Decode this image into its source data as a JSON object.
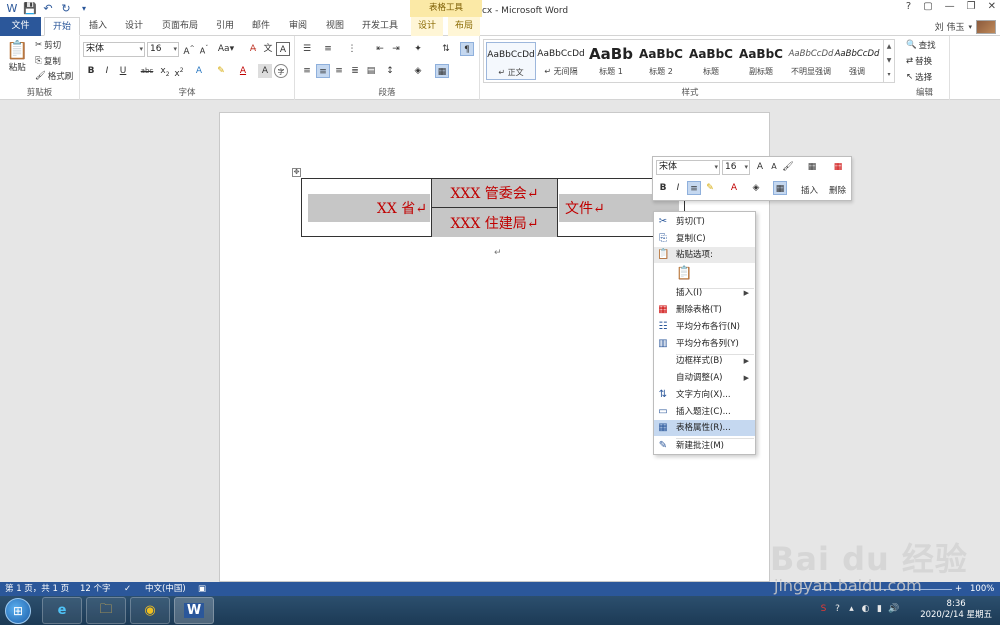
{
  "app": {
    "title": "公文制作.docx - Microsoft Word",
    "context_group": "表格工具",
    "window_controls": [
      "?",
      "▢",
      "—",
      "❐",
      "✕"
    ],
    "user": "刘 伟玉"
  },
  "tabs": [
    {
      "label": "文件"
    },
    {
      "label": "开始"
    },
    {
      "label": "插入"
    },
    {
      "label": "设计"
    },
    {
      "label": "页面布局"
    },
    {
      "label": "引用"
    },
    {
      "label": "邮件"
    },
    {
      "label": "审阅"
    },
    {
      "label": "视图"
    },
    {
      "label": "开发工具"
    },
    {
      "label": "设计"
    },
    {
      "label": "布局"
    }
  ],
  "ribbon": {
    "clipboard": {
      "paste": "粘贴",
      "cut": "剪切",
      "copy": "复制",
      "format_painter": "格式刷",
      "label": "剪贴板"
    },
    "font": {
      "name": "宋体",
      "size": "16",
      "label": "字体",
      "grow": "A",
      "shrink": "A",
      "aa": "Aa"
    },
    "paragraph": {
      "label": "段落"
    },
    "styles": {
      "label": "样式",
      "items": [
        {
          "sample": "AaBbCcDd",
          "name": "↵ 正文"
        },
        {
          "sample": "AaBbCcDd",
          "name": "↵ 无间隔"
        },
        {
          "sample": "AaBb",
          "name": "标题 1"
        },
        {
          "sample": "AaBbC",
          "name": "标题 2"
        },
        {
          "sample": "AaBbC",
          "name": "标题"
        },
        {
          "sample": "AaBbC",
          "name": "副标题"
        },
        {
          "sample": "AaBbCcDd",
          "name": "不明显强调"
        },
        {
          "sample": "AaBbCcDd",
          "name": "强调"
        }
      ]
    },
    "editing": {
      "find": "查找",
      "replace": "替换",
      "select": "选择",
      "label": "编辑"
    }
  },
  "document": {
    "cells": {
      "province": "XX 省↵",
      "org1": "XXX 管委会↵",
      "org2": "XXX 住建局↵",
      "doc": "文件↵"
    },
    "para_mark": "↵"
  },
  "mini_toolbar": {
    "font": "宋体",
    "size": "16",
    "insert": "插入",
    "delete": "删除"
  },
  "context_menu": [
    {
      "label": "剪切(T)",
      "icon": "scissors-icon",
      "glyph": "✂"
    },
    {
      "label": "复制(C)",
      "icon": "copy-icon",
      "glyph": "⎘"
    },
    {
      "label": "粘贴选项:",
      "icon": "paste-icon",
      "glyph": "📋"
    },
    {
      "label": "插入(I)",
      "submenu": true
    },
    {
      "label": "删除表格(T)",
      "icon": "delete-table-icon",
      "glyph": "▦"
    },
    {
      "label": "平均分布各行(N)",
      "icon": "distribute-rows-icon",
      "glyph": "☷"
    },
    {
      "label": "平均分布各列(Y)",
      "icon": "distribute-columns-icon",
      "glyph": "▥"
    },
    {
      "label": "边框样式(B)",
      "submenu": true
    },
    {
      "label": "自动调整(A)",
      "submenu": true
    },
    {
      "label": "文字方向(X)...",
      "icon": "text-direction-icon",
      "glyph": "⇅"
    },
    {
      "label": "插入题注(C)...",
      "icon": "caption-icon",
      "glyph": "▭"
    },
    {
      "label": "表格属性(R)...",
      "icon": "table-properties-icon",
      "glyph": "▦"
    },
    {
      "label": "新建批注(M)",
      "icon": "comment-icon",
      "glyph": "✎"
    }
  ],
  "statusbar": {
    "page": "第 1 页，共 1 页",
    "words": "12 个字",
    "language": "中文(中国)",
    "zoom": "100%"
  },
  "taskbar": {
    "time": "8:36",
    "date": "2020/2/14 星期五"
  },
  "watermark": {
    "logo": "Bai du 经验",
    "url": "jingyan.baidu.com"
  }
}
